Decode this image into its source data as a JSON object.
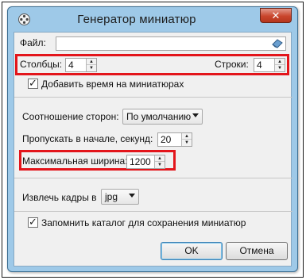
{
  "window": {
    "title": "Генератор миниатюр",
    "close_label": "✕"
  },
  "file": {
    "label": "Файл:",
    "value": ""
  },
  "grid": {
    "columns_label": "Столбцы:",
    "columns_value": "4",
    "rows_label": "Строки:",
    "rows_value": "4"
  },
  "add_time": {
    "label": "Добавить время на миниатюрах",
    "checked": true
  },
  "aspect": {
    "label": "Соотношение сторон:",
    "value": "По умолчанию"
  },
  "skip": {
    "label": "Пропускать в начале, секунд:",
    "value": "20"
  },
  "max_width": {
    "label": "Максимальная ширина:",
    "value": "1200"
  },
  "extract": {
    "label": "Извлечь кадры в",
    "value": "jpg"
  },
  "remember": {
    "label": "Запомнить каталог для сохранения миниатюр",
    "checked": true
  },
  "buttons": {
    "ok": "OK",
    "cancel": "Отмена"
  },
  "icons": {
    "app": "film-reel-icon",
    "browse": "eraser-icon"
  },
  "colors": {
    "highlight": "#e3151b",
    "title_bar": "#9ec9e8",
    "close": "#c9452c"
  }
}
